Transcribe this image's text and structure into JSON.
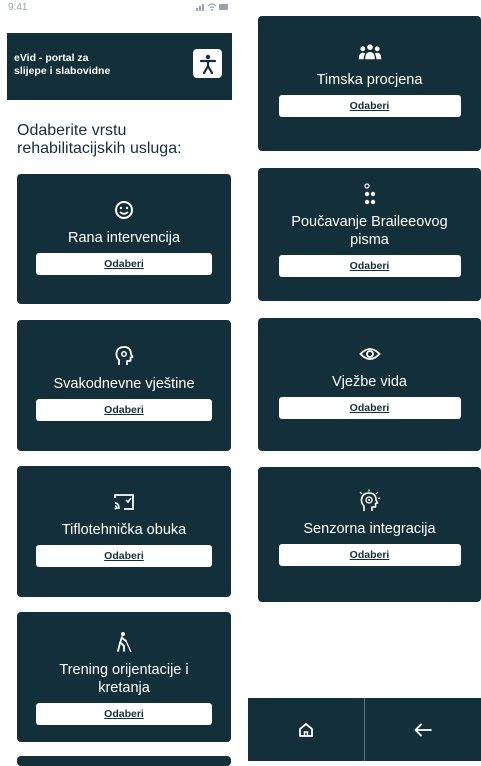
{
  "status_bar": {
    "time": "9:41",
    "icons_text": "∥• ▬"
  },
  "header": {
    "title": "eVid - portal za\nslijepe i slabovidne",
    "accessibility_icon": "accessibility-person-icon"
  },
  "prompt": "Odaberite vrstu\nrehabilitacijskih usluga:",
  "select_label": "Odaberi",
  "services": [
    {
      "title": "Rana intervencija",
      "icon": "smiley-face-icon"
    },
    {
      "title": "Svakodnevne vještine",
      "icon": "head-gear-icon"
    },
    {
      "title": "Tiflotehnička obuka",
      "icon": "cast-screen-icon"
    },
    {
      "title": "Trening orijentacije i kretanja",
      "icon": "blind-person-cane-icon"
    },
    {
      "title": "Timska procjena",
      "icon": "team-group-icon"
    },
    {
      "title": "Poučavanje Braileeovog pisma",
      "icon": "braille-dots-icon"
    },
    {
      "title": "Vježbe vida",
      "icon": "eye-icon"
    },
    {
      "title": "Senzorna integracija",
      "icon": "sensory-head-icon"
    }
  ],
  "nav": {
    "home_icon": "home-icon",
    "back_icon": "arrow-left-icon"
  },
  "colors": {
    "primary": "#13303a",
    "background": "#ffffff",
    "button_bg": "#ffffff"
  }
}
